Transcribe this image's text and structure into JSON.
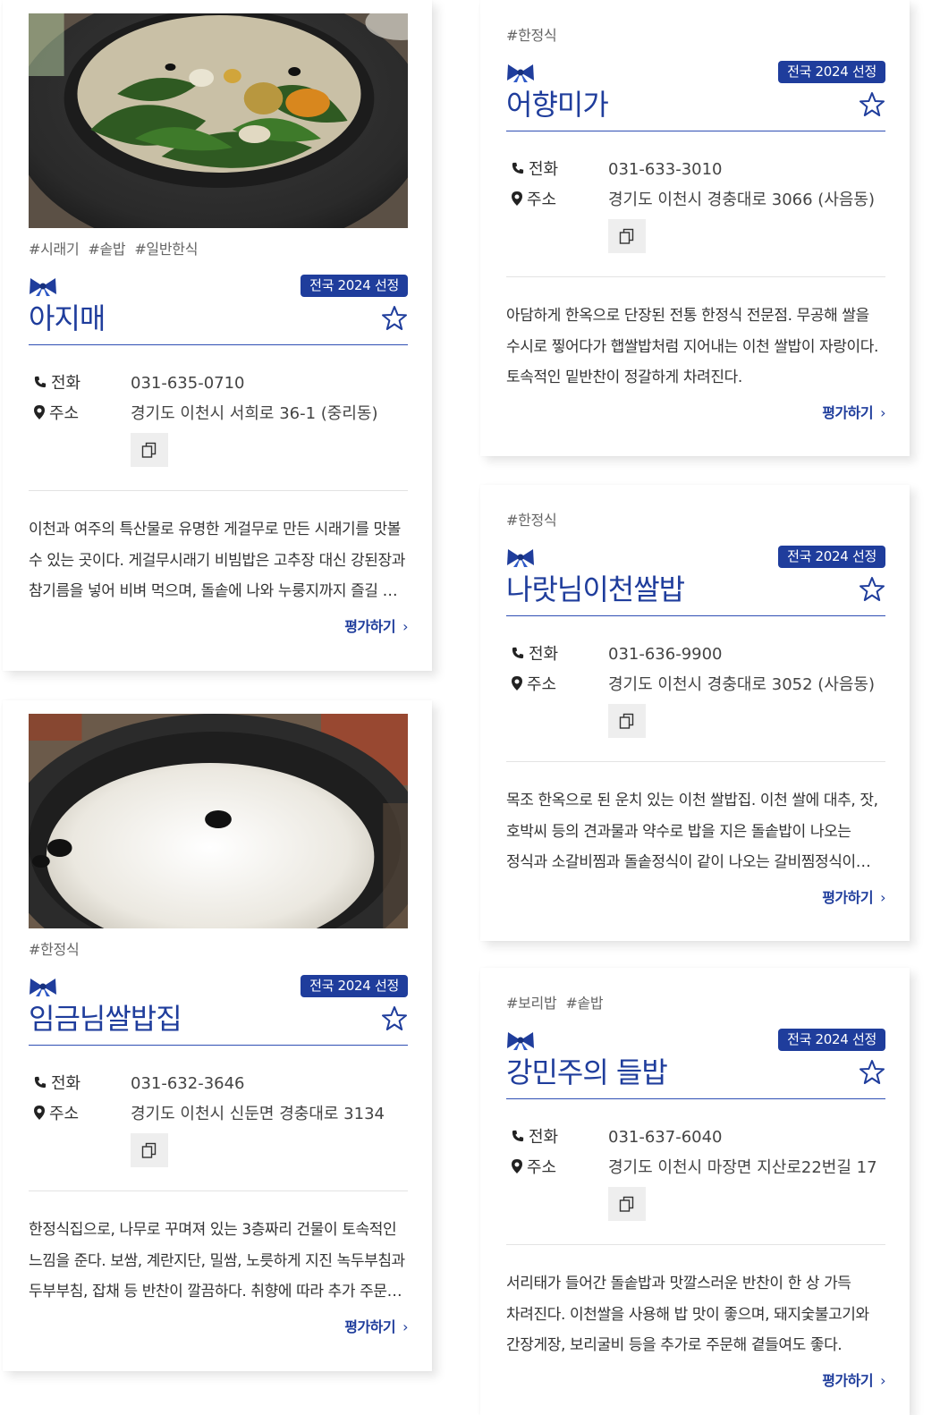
{
  "common": {
    "badge": "전국 2024 선정",
    "phone_label": "전화",
    "address_label": "주소",
    "rate_label": "평가하기",
    "chevron": "›"
  },
  "cards": [
    {
      "image_desc": "stone pot bibimbap with vegetables",
      "tags": [
        "#시래기",
        "#솥밥",
        "#일반한식"
      ],
      "name": "아지매",
      "phone": "031-635-0710",
      "address": "경기도 이천시 서희로 36-1 (중리동)",
      "desc": "이천과 여주의 특산물로 유명한 게걸무로 만든 시래기를 맛볼 수 있는 곳이다. 게걸무시래기 비빔밥은 고추장 대신 강된장과 참기름을 넣어 비벼 먹으며, 돌솥에 나와 누룽지까지 즐길 수 있다."
    },
    {
      "tags": [
        "#한정식"
      ],
      "name": "어향미가",
      "phone": "031-633-3010",
      "address": "경기도 이천시 경충대로 3066 (사음동)",
      "desc": "아담하게 한옥으로 단장된 전통 한정식 전문점. 무공해 쌀을 수시로 찧어다가 햅쌀밥처럼 지어내는 이천 쌀밥이 자랑이다. 토속적인 밑반찬이 정갈하게 차려진다."
    },
    {
      "image_desc": "stone pot white rice with black beans",
      "tags": [
        "#한정식"
      ],
      "name": "임금님쌀밥집",
      "phone": "031-632-3646",
      "address": "경기도 이천시 신둔면 경충대로 3134",
      "desc": "한정식집으로, 나무로 꾸며져 있는 3층짜리 건물이 토속적인 느낌을 준다. 보쌈, 계란지단, 밀쌈, 노릇하게 지진 녹두부침과 두부부침, 잡채 등 반찬이 깔끔하다. 취향에 따라 추가 주문도 가능하다."
    },
    {
      "tags": [
        "#한정식"
      ],
      "name": "나랏님이천쌀밥",
      "phone": "031-636-9900",
      "address": "경기도 이천시 경충대로 3052 (사음동)",
      "desc": "목조 한옥으로 된 운치 있는 이천 쌀밥집. 이천 쌀에 대추, 잣, 호박씨 등의 견과물과 약수로 밥을 지은 돌솥밥이 나오는 정식과 소갈비찜과 돌솥정식이 같이 나오는 갈비찜정식이 있다."
    },
    {
      "tags": [
        "#보리밥",
        "#솥밥"
      ],
      "name": "강민주의 들밥",
      "phone": "031-637-6040",
      "address": "경기도 이천시 마장면 지산로22번길 17",
      "desc": "서리태가 들어간 돌솥밥과 맛깔스러운 반찬이 한 상 가득 차려진다. 이천쌀을 사용해 밥 맛이 좋으며, 돼지숯불고기와 간장게장, 보리굴비 등을 추가로 주문해 곁들여도 좋다."
    }
  ]
}
